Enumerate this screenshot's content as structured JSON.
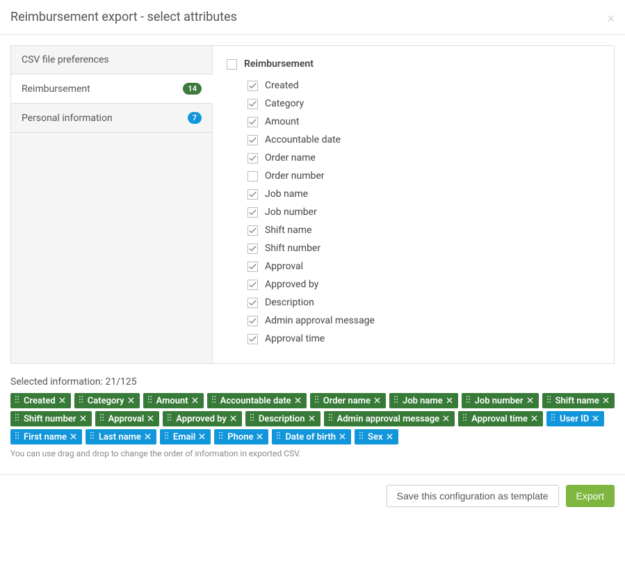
{
  "header": {
    "title": "Reimbursement export - select attributes"
  },
  "sidebar": {
    "items": [
      {
        "label": "CSV file preferences",
        "badge": null,
        "active": false
      },
      {
        "label": "Reimbursement",
        "badge": "14",
        "badge_color": "green",
        "active": true
      },
      {
        "label": "Personal information",
        "badge": "7",
        "badge_color": "blue",
        "active": false
      }
    ]
  },
  "content": {
    "group_label": "Reimbursement",
    "group_checked": false,
    "attributes": [
      {
        "label": "Created",
        "checked": true
      },
      {
        "label": "Category",
        "checked": true
      },
      {
        "label": "Amount",
        "checked": true
      },
      {
        "label": "Accountable date",
        "checked": true
      },
      {
        "label": "Order name",
        "checked": true
      },
      {
        "label": "Order number",
        "checked": false
      },
      {
        "label": "Job name",
        "checked": true
      },
      {
        "label": "Job number",
        "checked": true
      },
      {
        "label": "Shift name",
        "checked": true
      },
      {
        "label": "Shift number",
        "checked": true
      },
      {
        "label": "Approval",
        "checked": true
      },
      {
        "label": "Approved by",
        "checked": true
      },
      {
        "label": "Description",
        "checked": true
      },
      {
        "label": "Admin approval message",
        "checked": true
      },
      {
        "label": "Approval time",
        "checked": true
      }
    ]
  },
  "selected": {
    "label_prefix": "Selected information: ",
    "count_text": "21/125",
    "chips": [
      {
        "label": "Created",
        "color": "green"
      },
      {
        "label": "Category",
        "color": "green"
      },
      {
        "label": "Amount",
        "color": "green"
      },
      {
        "label": "Accountable date",
        "color": "green"
      },
      {
        "label": "Order name",
        "color": "green"
      },
      {
        "label": "Job name",
        "color": "green"
      },
      {
        "label": "Job number",
        "color": "green"
      },
      {
        "label": "Shift name",
        "color": "green"
      },
      {
        "label": "Shift number",
        "color": "green"
      },
      {
        "label": "Approval",
        "color": "green"
      },
      {
        "label": "Approved by",
        "color": "green"
      },
      {
        "label": "Description",
        "color": "green"
      },
      {
        "label": "Admin approval message",
        "color": "green"
      },
      {
        "label": "Approval time",
        "color": "green"
      },
      {
        "label": "User ID",
        "color": "blue"
      },
      {
        "label": "First name",
        "color": "blue"
      },
      {
        "label": "Last name",
        "color": "blue"
      },
      {
        "label": "Email",
        "color": "blue"
      },
      {
        "label": "Phone",
        "color": "blue"
      },
      {
        "label": "Date of birth",
        "color": "blue"
      },
      {
        "label": "Sex",
        "color": "blue"
      }
    ],
    "hint": "You can use drag and drop to change the order of information in exported CSV."
  },
  "footer": {
    "save_template_label": "Save this configuration as template",
    "export_label": "Export"
  }
}
